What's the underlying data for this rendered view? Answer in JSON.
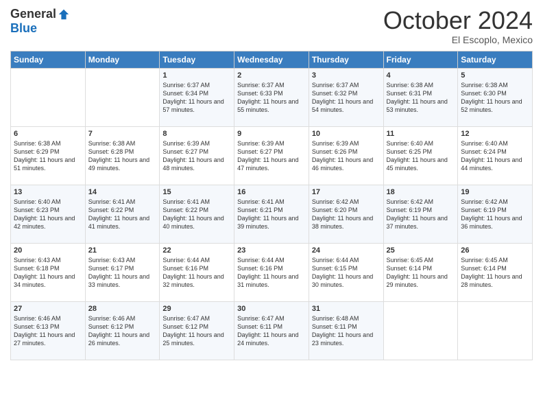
{
  "header": {
    "logo_general": "General",
    "logo_blue": "Blue",
    "month": "October 2024",
    "location": "El Escoplo, Mexico"
  },
  "days_of_week": [
    "Sunday",
    "Monday",
    "Tuesday",
    "Wednesday",
    "Thursday",
    "Friday",
    "Saturday"
  ],
  "weeks": [
    [
      {
        "day": "",
        "content": ""
      },
      {
        "day": "",
        "content": ""
      },
      {
        "day": "1",
        "content": "Sunrise: 6:37 AM\nSunset: 6:34 PM\nDaylight: 11 hours and 57 minutes."
      },
      {
        "day": "2",
        "content": "Sunrise: 6:37 AM\nSunset: 6:33 PM\nDaylight: 11 hours and 55 minutes."
      },
      {
        "day": "3",
        "content": "Sunrise: 6:37 AM\nSunset: 6:32 PM\nDaylight: 11 hours and 54 minutes."
      },
      {
        "day": "4",
        "content": "Sunrise: 6:38 AM\nSunset: 6:31 PM\nDaylight: 11 hours and 53 minutes."
      },
      {
        "day": "5",
        "content": "Sunrise: 6:38 AM\nSunset: 6:30 PM\nDaylight: 11 hours and 52 minutes."
      }
    ],
    [
      {
        "day": "6",
        "content": "Sunrise: 6:38 AM\nSunset: 6:29 PM\nDaylight: 11 hours and 51 minutes."
      },
      {
        "day": "7",
        "content": "Sunrise: 6:38 AM\nSunset: 6:28 PM\nDaylight: 11 hours and 49 minutes."
      },
      {
        "day": "8",
        "content": "Sunrise: 6:39 AM\nSunset: 6:27 PM\nDaylight: 11 hours and 48 minutes."
      },
      {
        "day": "9",
        "content": "Sunrise: 6:39 AM\nSunset: 6:27 PM\nDaylight: 11 hours and 47 minutes."
      },
      {
        "day": "10",
        "content": "Sunrise: 6:39 AM\nSunset: 6:26 PM\nDaylight: 11 hours and 46 minutes."
      },
      {
        "day": "11",
        "content": "Sunrise: 6:40 AM\nSunset: 6:25 PM\nDaylight: 11 hours and 45 minutes."
      },
      {
        "day": "12",
        "content": "Sunrise: 6:40 AM\nSunset: 6:24 PM\nDaylight: 11 hours and 44 minutes."
      }
    ],
    [
      {
        "day": "13",
        "content": "Sunrise: 6:40 AM\nSunset: 6:23 PM\nDaylight: 11 hours and 42 minutes."
      },
      {
        "day": "14",
        "content": "Sunrise: 6:41 AM\nSunset: 6:22 PM\nDaylight: 11 hours and 41 minutes."
      },
      {
        "day": "15",
        "content": "Sunrise: 6:41 AM\nSunset: 6:22 PM\nDaylight: 11 hours and 40 minutes."
      },
      {
        "day": "16",
        "content": "Sunrise: 6:41 AM\nSunset: 6:21 PM\nDaylight: 11 hours and 39 minutes."
      },
      {
        "day": "17",
        "content": "Sunrise: 6:42 AM\nSunset: 6:20 PM\nDaylight: 11 hours and 38 minutes."
      },
      {
        "day": "18",
        "content": "Sunrise: 6:42 AM\nSunset: 6:19 PM\nDaylight: 11 hours and 37 minutes."
      },
      {
        "day": "19",
        "content": "Sunrise: 6:42 AM\nSunset: 6:19 PM\nDaylight: 11 hours and 36 minutes."
      }
    ],
    [
      {
        "day": "20",
        "content": "Sunrise: 6:43 AM\nSunset: 6:18 PM\nDaylight: 11 hours and 34 minutes."
      },
      {
        "day": "21",
        "content": "Sunrise: 6:43 AM\nSunset: 6:17 PM\nDaylight: 11 hours and 33 minutes."
      },
      {
        "day": "22",
        "content": "Sunrise: 6:44 AM\nSunset: 6:16 PM\nDaylight: 11 hours and 32 minutes."
      },
      {
        "day": "23",
        "content": "Sunrise: 6:44 AM\nSunset: 6:16 PM\nDaylight: 11 hours and 31 minutes."
      },
      {
        "day": "24",
        "content": "Sunrise: 6:44 AM\nSunset: 6:15 PM\nDaylight: 11 hours and 30 minutes."
      },
      {
        "day": "25",
        "content": "Sunrise: 6:45 AM\nSunset: 6:14 PM\nDaylight: 11 hours and 29 minutes."
      },
      {
        "day": "26",
        "content": "Sunrise: 6:45 AM\nSunset: 6:14 PM\nDaylight: 11 hours and 28 minutes."
      }
    ],
    [
      {
        "day": "27",
        "content": "Sunrise: 6:46 AM\nSunset: 6:13 PM\nDaylight: 11 hours and 27 minutes."
      },
      {
        "day": "28",
        "content": "Sunrise: 6:46 AM\nSunset: 6:12 PM\nDaylight: 11 hours and 26 minutes."
      },
      {
        "day": "29",
        "content": "Sunrise: 6:47 AM\nSunset: 6:12 PM\nDaylight: 11 hours and 25 minutes."
      },
      {
        "day": "30",
        "content": "Sunrise: 6:47 AM\nSunset: 6:11 PM\nDaylight: 11 hours and 24 minutes."
      },
      {
        "day": "31",
        "content": "Sunrise: 6:48 AM\nSunset: 6:11 PM\nDaylight: 11 hours and 23 minutes."
      },
      {
        "day": "",
        "content": ""
      },
      {
        "day": "",
        "content": ""
      }
    ]
  ]
}
